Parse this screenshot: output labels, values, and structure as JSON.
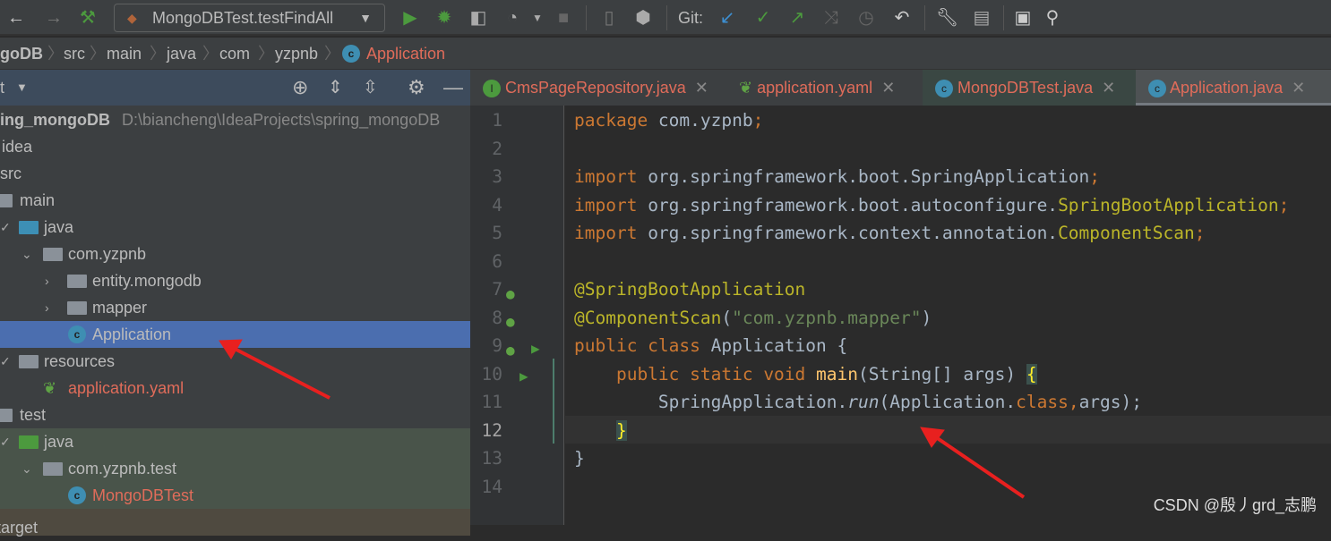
{
  "toolbar": {
    "run_config": "MongoDBTest.testFindAll",
    "git_label": "Git:"
  },
  "breadcrumb": [
    "goDB",
    "src",
    "main",
    "java",
    "com",
    "yzpnb",
    "Application"
  ],
  "project_panel": {
    "title": "t"
  },
  "tree": [
    {
      "label": "ing_mongoDB",
      "path": "D:\\biancheng\\IdeaProjects\\spring_mongoDB"
    },
    {
      "label": "idea"
    },
    {
      "label": "src"
    },
    {
      "label": "main"
    },
    {
      "label": "java"
    },
    {
      "label": "com.yzpnb"
    },
    {
      "label": "entity.mongodb"
    },
    {
      "label": "mapper"
    },
    {
      "label": "Application"
    },
    {
      "label": "resources"
    },
    {
      "label": "application.yaml"
    },
    {
      "label": "test"
    },
    {
      "label": "java"
    },
    {
      "label": "com.yzpnb.test"
    },
    {
      "label": "MongoDBTest"
    },
    {
      "label": "target"
    }
  ],
  "tabs": [
    {
      "label": "CmsPageRepository.java"
    },
    {
      "label": "application.yaml"
    },
    {
      "label": "MongoDBTest.java"
    },
    {
      "label": "Application.java",
      "active": true
    }
  ],
  "editor": {
    "line_numbers": [
      "1",
      "2",
      "3",
      "4",
      "5",
      "6",
      "7",
      "8",
      "9",
      "10",
      "11",
      "12",
      "13",
      "14"
    ],
    "lines": [
      [
        [
          "package ",
          "kw"
        ],
        [
          "com.yzpnb",
          "pl"
        ],
        [
          ";",
          "kw"
        ]
      ],
      [],
      [
        [
          "import ",
          "kw"
        ],
        [
          "org.springframework.boot.SpringApplication",
          "pl"
        ],
        [
          ";",
          "kw"
        ]
      ],
      [
        [
          "import ",
          "kw"
        ],
        [
          "org.springframework.boot.autoconfigure.",
          "pl"
        ],
        [
          "SpringBootApplication",
          "an"
        ],
        [
          ";",
          "kw"
        ]
      ],
      [
        [
          "import ",
          "kw"
        ],
        [
          "org.springframework.context.annotation.",
          "pl"
        ],
        [
          "ComponentScan",
          "an"
        ],
        [
          ";",
          "kw"
        ]
      ],
      [],
      [
        [
          "@SpringBootApplication",
          "an"
        ]
      ],
      [
        [
          "@ComponentScan",
          "an"
        ],
        [
          "(",
          "pl"
        ],
        [
          "\"com.yzpnb.mapper\"",
          "st"
        ],
        [
          ")",
          "pl"
        ]
      ],
      [
        [
          "public class ",
          "kw"
        ],
        [
          "Application {",
          "pl"
        ]
      ],
      [
        [
          "    public static void ",
          "kw"
        ],
        [
          "main",
          "fn"
        ],
        [
          "(String[] args) ",
          "pl"
        ],
        [
          "{",
          "br"
        ]
      ],
      [
        [
          "        SpringApplication.",
          "pl"
        ],
        [
          "run",
          "pl it"
        ],
        [
          "(Application.",
          "pl"
        ],
        [
          "class",
          "kw"
        ],
        [
          ",",
          "kw"
        ],
        [
          "args);",
          "pl"
        ]
      ],
      [
        [
          "    ",
          "pl"
        ],
        [
          "}",
          "br"
        ]
      ],
      [
        [
          "}",
          "pl"
        ]
      ],
      []
    ],
    "current_line": "12"
  },
  "watermark": "CSDN @殷丿grd_志鹏",
  "colors": {
    "accent": "#4b6eaf",
    "arrow": "#e8201f",
    "modified_file": "#e06c5a"
  }
}
